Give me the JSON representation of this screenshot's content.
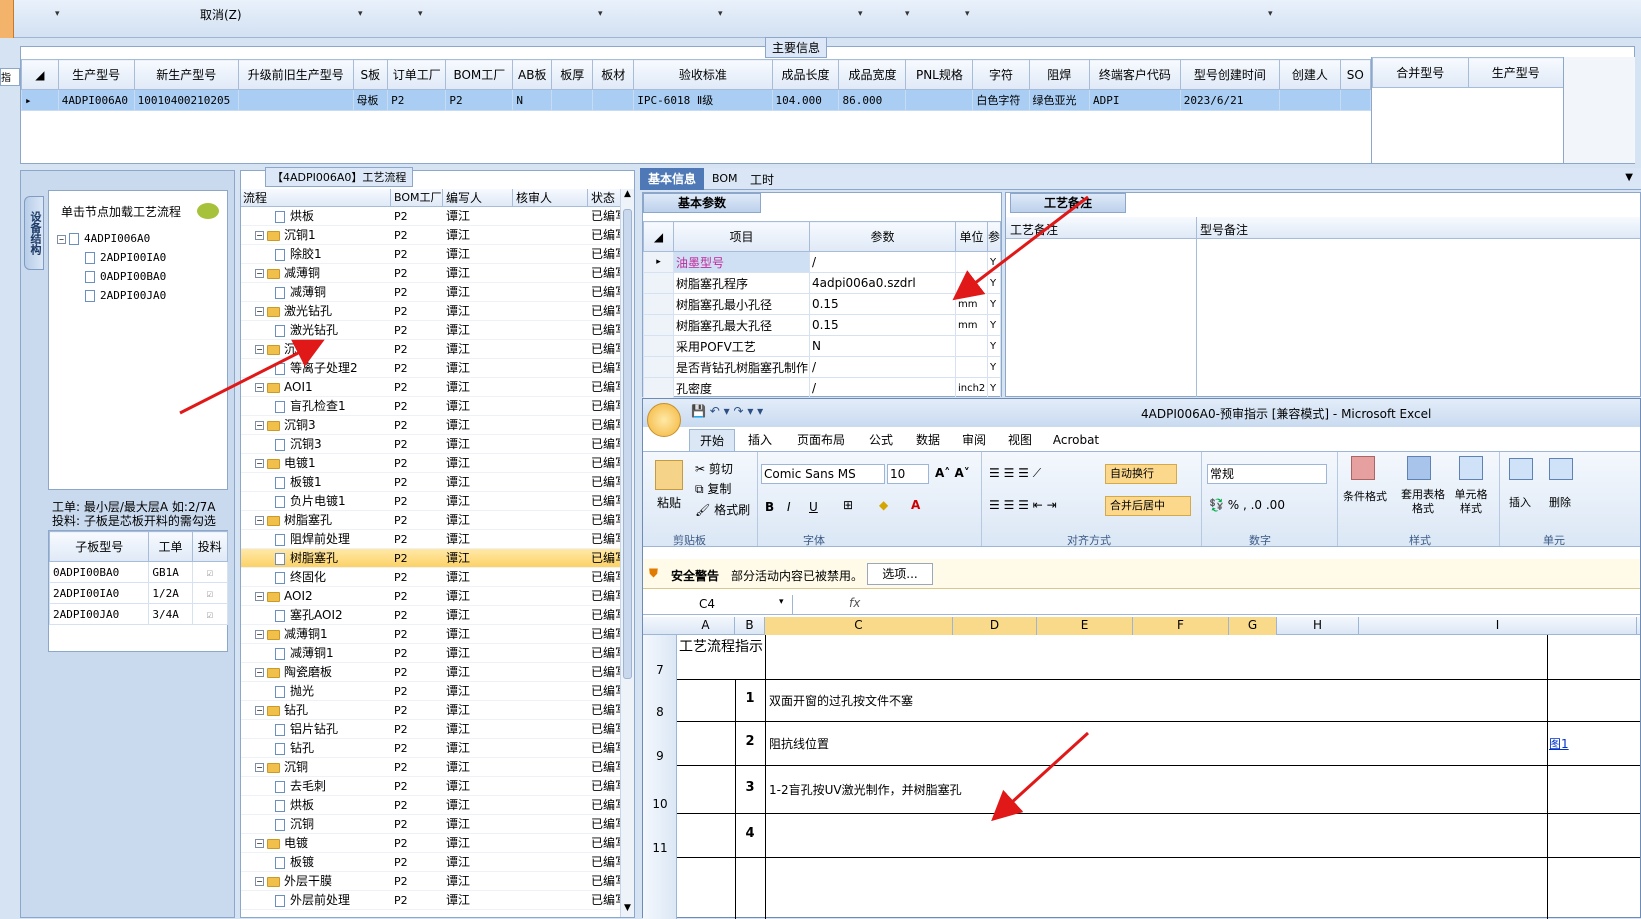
{
  "top_toolbar": {
    "cancel_label": "取消(Z)",
    "left_stub": "指示"
  },
  "main_info": {
    "caption": "主要信息",
    "columns": [
      "生产型号",
      "新生产型号",
      "升级前旧生产型号",
      "S板",
      "订单工厂",
      "BOM工厂",
      "AB板",
      "板厚",
      "板材",
      "验收标准",
      "成品长度",
      "成品宽度",
      "PNL规格",
      "字符",
      "阻焊",
      "终端客户代码",
      "型号创建时间",
      "创建人",
      "SO"
    ],
    "row": [
      "4ADPI006A0",
      "10010400210205",
      "",
      "母板",
      "P2",
      "P2",
      "N",
      "",
      "",
      "IPC-6018 Ⅱ级",
      "104.000",
      "86.000",
      "",
      "白色字符",
      "绿色亚光",
      "ADPI",
      "2023/6/21",
      "",
      ""
    ],
    "merge_columns": [
      "合并型号",
      "生产型号"
    ]
  },
  "tree_panel": {
    "tab_label": "设备结构",
    "hint": "单击节点加载工艺流程",
    "root": "4ADPI006A0",
    "children": [
      "2ADPI00IA0",
      "0ADPI00BA0",
      "2ADPI00JA0"
    ],
    "info_line1": "工单: 最小层/最大层A 如:2/7A",
    "info_line2": "投料: 子板是芯板开料的需勾选",
    "sub_columns": [
      "子板型号",
      "工单",
      "投料"
    ],
    "sub_rows": [
      [
        "0ADPI00BA0",
        "GB1A"
      ],
      [
        "2ADPI00IA0",
        "1/2A"
      ],
      [
        "2ADPI00JA0",
        "3/4A"
      ]
    ]
  },
  "flow_panel": {
    "title": "【4ADPI006A0】工艺流程",
    "columns": [
      "流程",
      "BOM工厂",
      "编写人",
      "核审人",
      "状态"
    ],
    "rows": [
      {
        "name": "烘板",
        "folder": false,
        "bom": "P2",
        "writer": "谭江",
        "status": "已编写"
      },
      {
        "name": "沉铜1",
        "folder": true,
        "bom": "P2",
        "writer": "谭江",
        "status": "已编写"
      },
      {
        "name": "除胶1",
        "folder": false,
        "bom": "P2",
        "writer": "谭江",
        "status": "已编写"
      },
      {
        "name": "减薄铜",
        "folder": true,
        "bom": "P2",
        "writer": "谭江",
        "status": "已编写"
      },
      {
        "name": "减薄铜",
        "folder": false,
        "bom": "P2",
        "writer": "谭江",
        "status": "已编写"
      },
      {
        "name": "激光钻孔",
        "folder": true,
        "bom": "P2",
        "writer": "谭江",
        "status": "已编写"
      },
      {
        "name": "激光钻孔",
        "folder": false,
        "bom": "P2",
        "writer": "谭江",
        "status": "已编写"
      },
      {
        "name": "沉铜2",
        "folder": true,
        "bom": "P2",
        "writer": "谭江",
        "status": "已编写"
      },
      {
        "name": "等离子处理2",
        "folder": false,
        "bom": "P2",
        "writer": "谭江",
        "status": "已编写"
      },
      {
        "name": "AOI1",
        "folder": true,
        "bom": "P2",
        "writer": "谭江",
        "status": "已编写"
      },
      {
        "name": "盲孔检查1",
        "folder": false,
        "bom": "P2",
        "writer": "谭江",
        "status": "已编写"
      },
      {
        "name": "沉铜3",
        "folder": true,
        "bom": "P2",
        "writer": "谭江",
        "status": "已编写"
      },
      {
        "name": "沉铜3",
        "folder": false,
        "bom": "P2",
        "writer": "谭江",
        "status": "已编写"
      },
      {
        "name": "电镀1",
        "folder": true,
        "bom": "P2",
        "writer": "谭江",
        "status": "已编写"
      },
      {
        "name": "板镀1",
        "folder": false,
        "bom": "P2",
        "writer": "谭江",
        "status": "已编写"
      },
      {
        "name": "负片电镀1",
        "folder": false,
        "bom": "P2",
        "writer": "谭江",
        "status": "已编写"
      },
      {
        "name": "树脂塞孔",
        "folder": true,
        "bom": "P2",
        "writer": "谭江",
        "status": "已编写"
      },
      {
        "name": "阻焊前处理",
        "folder": false,
        "bom": "P2",
        "writer": "谭江",
        "status": "已编写"
      },
      {
        "name": "树脂塞孔",
        "folder": false,
        "bom": "P2",
        "writer": "谭江",
        "status": "已编写",
        "selected": true
      },
      {
        "name": "终固化",
        "folder": false,
        "bom": "P2",
        "writer": "谭江",
        "status": "已编写"
      },
      {
        "name": "AOI2",
        "folder": true,
        "bom": "P2",
        "writer": "谭江",
        "status": "已编写"
      },
      {
        "name": "塞孔AOI2",
        "folder": false,
        "bom": "P2",
        "writer": "谭江",
        "status": "已编写"
      },
      {
        "name": "减薄铜1",
        "folder": true,
        "bom": "P2",
        "writer": "谭江",
        "status": "已编写"
      },
      {
        "name": "减薄铜1",
        "folder": false,
        "bom": "P2",
        "writer": "谭江",
        "status": "已编写"
      },
      {
        "name": "陶瓷磨板",
        "folder": true,
        "bom": "P2",
        "writer": "谭江",
        "status": "已编写"
      },
      {
        "name": "抛光",
        "folder": false,
        "bom": "P2",
        "writer": "谭江",
        "status": "已编写"
      },
      {
        "name": "钻孔",
        "folder": true,
        "bom": "P2",
        "writer": "谭江",
        "status": "已编写"
      },
      {
        "name": "铝片钻孔",
        "folder": false,
        "bom": "P2",
        "writer": "谭江",
        "status": "已编写"
      },
      {
        "name": "钻孔",
        "folder": false,
        "bom": "P2",
        "writer": "谭江",
        "status": "已编写"
      },
      {
        "name": "沉铜",
        "folder": true,
        "bom": "P2",
        "writer": "谭江",
        "status": "已编写"
      },
      {
        "name": "去毛刺",
        "folder": false,
        "bom": "P2",
        "writer": "谭江",
        "status": "已编写"
      },
      {
        "name": "烘板",
        "folder": false,
        "bom": "P2",
        "writer": "谭江",
        "status": "已编写"
      },
      {
        "name": "沉铜",
        "folder": false,
        "bom": "P2",
        "writer": "谭江",
        "status": "已编写"
      },
      {
        "name": "电镀",
        "folder": true,
        "bom": "P2",
        "writer": "谭江",
        "status": "已编写"
      },
      {
        "name": "板镀",
        "folder": false,
        "bom": "P2",
        "writer": "谭江",
        "status": "已编写"
      },
      {
        "name": "外层干膜",
        "folder": true,
        "bom": "P2",
        "writer": "谭江",
        "status": "已编写"
      },
      {
        "name": "外层前处理",
        "folder": false,
        "bom": "P2",
        "writer": "谭江",
        "status": "已编写"
      }
    ]
  },
  "detail_tabs": {
    "tabs": [
      "基本信息",
      "BOM",
      "工时"
    ],
    "sub_tab": "基本参数",
    "notes_tab": "工艺备注",
    "notes_cols": [
      "工艺备注",
      "型号备注"
    ]
  },
  "params": {
    "columns": [
      "项目",
      "参数",
      "单位",
      "参"
    ],
    "rows": [
      [
        "油墨型号",
        "/",
        "",
        "Y"
      ],
      [
        "树脂塞孔程序",
        "4adpi006a0.szdrl",
        "",
        "Y"
      ],
      [
        "树脂塞孔最小孔径",
        "0.15",
        "mm",
        "Y"
      ],
      [
        "树脂塞孔最大孔径",
        "0.15",
        "mm",
        "Y"
      ],
      [
        "采用POFV工艺",
        "N",
        "",
        "Y"
      ],
      [
        "是否背钻孔树脂塞孔制作",
        "/",
        "",
        "Y"
      ],
      [
        "孔密度",
        "/",
        "inch2",
        "Y"
      ]
    ]
  },
  "excel": {
    "title": "4ADPI006A0-预审指示  [兼容模式] - Microsoft Excel",
    "tabs": [
      "开始",
      "插入",
      "页面布局",
      "公式",
      "数据",
      "审阅",
      "视图",
      "Acrobat"
    ],
    "clipboard": {
      "paste": "粘贴",
      "cut": "剪切",
      "copy": "复制",
      "format": "格式刷",
      "group": "剪贴板"
    },
    "font": {
      "name": "Comic Sans MS",
      "size": "10",
      "group": "字体"
    },
    "align": {
      "wrap": "自动换行",
      "merge": "合并后居中",
      "group": "对齐方式"
    },
    "number": {
      "format": "常规",
      "group": "数字"
    },
    "styles": {
      "cond": "条件格式",
      "table": "套用表格格式",
      "cell": "单元格样式",
      "group": "样式"
    },
    "cells": {
      "insert": "插入",
      "delete": "删除",
      "group": "单元"
    },
    "security": {
      "label": "安全警告",
      "text": "部分活动内容已被禁用。",
      "button": "选项..."
    },
    "namebox": "C4",
    "fx": "fx",
    "col_headers": [
      "A",
      "B",
      "C",
      "D",
      "E",
      "F",
      "G",
      "H",
      "I"
    ],
    "title_cell": "工艺流程指示",
    "rows": [
      {
        "num": "7"
      },
      {
        "num": "8",
        "idx": "1",
        "text": "双面开窗的过孔按文件不塞"
      },
      {
        "num": "9",
        "idx": "2",
        "text": "阻抗线位置",
        "link": "图1"
      },
      {
        "num": "10",
        "idx": "3",
        "text": "1-2盲孔按UV激光制作，并树脂塞孔"
      },
      {
        "num": "11",
        "idx": "4",
        "text": ""
      }
    ]
  }
}
